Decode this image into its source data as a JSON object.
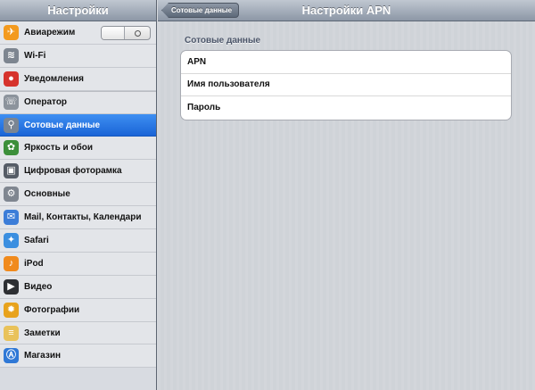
{
  "sidebar": {
    "title": "Настройки",
    "items": [
      {
        "label": "Авиарежим",
        "icon": "airplane-icon",
        "color": "#f39a1e",
        "glyph": "✈",
        "toggle": true,
        "toggle_state": "off"
      },
      {
        "label": "Wi-Fi",
        "icon": "wifi-icon",
        "color": "#7d8590",
        "glyph": "≋"
      },
      {
        "label": "Уведомления",
        "icon": "notifications-icon",
        "color": "#d6332c",
        "glyph": "●"
      },
      {
        "label": "Оператор",
        "icon": "phone-icon",
        "color": "#8c939c",
        "glyph": "☏"
      },
      {
        "label": "Сотовые данные",
        "icon": "antenna-icon",
        "color": "#7a8593",
        "glyph": "⚲",
        "selected": true
      },
      {
        "label": "Яркость и обои",
        "icon": "flower-icon",
        "color": "#3c8f3a",
        "glyph": "✿"
      },
      {
        "label": "Цифровая фоторамка",
        "icon": "photo-frame-icon",
        "color": "#555c66",
        "glyph": "▣"
      },
      {
        "label": "Основные",
        "icon": "gear-icon",
        "color": "#7f8690",
        "glyph": "⚙"
      },
      {
        "label": "Mail, Контакты, Календари",
        "icon": "mail-icon",
        "color": "#3c7dd8",
        "glyph": "✉"
      },
      {
        "label": "Safari",
        "icon": "compass-icon",
        "color": "#3b8fe0",
        "glyph": "✦"
      },
      {
        "label": "iPod",
        "icon": "ipod-icon",
        "color": "#f08a1d",
        "glyph": "♪"
      },
      {
        "label": "Видео",
        "icon": "video-icon",
        "color": "#2d2f33",
        "glyph": "▶"
      },
      {
        "label": "Фотографии",
        "icon": "sunflower-icon",
        "color": "#e8a21c",
        "glyph": "✹"
      },
      {
        "label": "Заметки",
        "icon": "notes-icon",
        "color": "#e9c25a",
        "glyph": "≡"
      },
      {
        "label": "Магазин",
        "icon": "app-store-icon",
        "color": "#2f78d6",
        "glyph": "Ⓐ"
      }
    ]
  },
  "detail": {
    "title": "Настройки APN",
    "back_label": "Сотовые данные",
    "section_header": "Сотовые данные",
    "fields": [
      {
        "label": "APN"
      },
      {
        "label": "Имя пользователя"
      },
      {
        "label": "Пароль"
      }
    ]
  }
}
